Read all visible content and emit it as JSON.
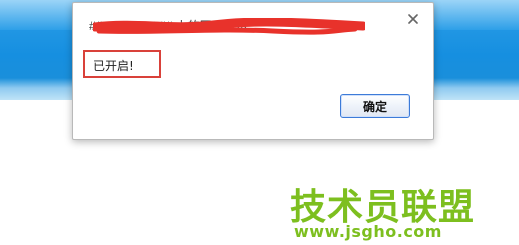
{
  "dialog": {
    "title": "###.###.###.## 上的网页显示",
    "message": "已开启!",
    "ok_label": "确定",
    "close_glyph": "✕"
  },
  "watermark": {
    "main": "技术员联盟",
    "url": "www.jsgho.com"
  },
  "colors": {
    "header_blue": "#1a8fdb",
    "redaction_red": "#e8322b",
    "message_border": "#d9413a",
    "watermark_green": "#7dbf1f"
  }
}
